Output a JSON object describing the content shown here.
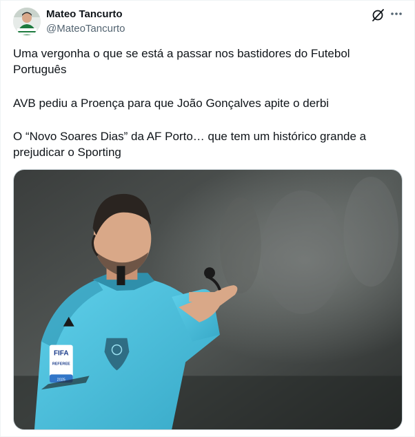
{
  "author": {
    "name": "Mateo Tancurto",
    "handle": "@MateoTancurto"
  },
  "tweet": {
    "paragraphs": [
      "Uma vergonha o que se está a passar nos bastidores do Futebol Português",
      "AVB pediu a Proença para que João Gonçalves apite o derbi",
      "O “Novo Soares Dias” da AF Porto… que tem um histórico grande a prejudicar o Sporting"
    ]
  },
  "media": {
    "badge_fifa": "FIFA",
    "badge_referee": "REFEREE",
    "badge_year": "2025"
  },
  "icons": {
    "grok": "grok-icon",
    "more": "more-options-icon",
    "avatar": "avatar"
  },
  "colors": {
    "text": "#0f1419",
    "secondary": "#536471",
    "jersey": "#4fc3e0",
    "border": "#cfd9de"
  }
}
